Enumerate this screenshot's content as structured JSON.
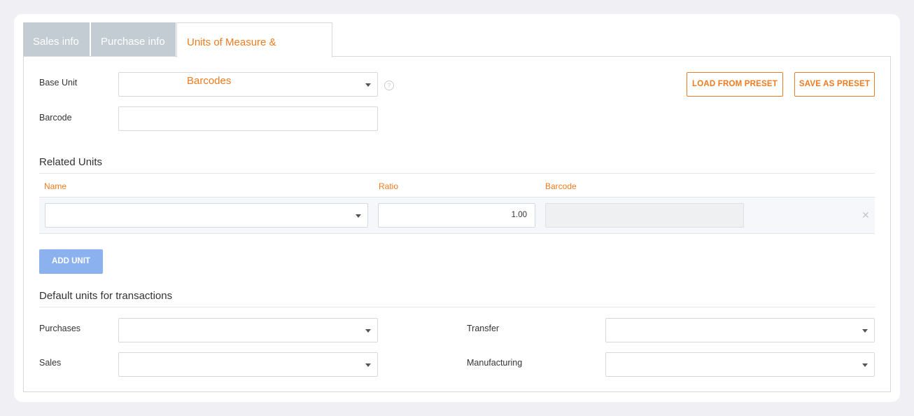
{
  "tabs": [
    {
      "label": "Sales info"
    },
    {
      "label": "Purchase info"
    },
    {
      "label": "Units of Measure & Barcodes"
    }
  ],
  "form": {
    "base_unit_label": "Base Unit",
    "base_unit_value": "",
    "barcode_label": "Barcode",
    "barcode_value": ""
  },
  "actions": {
    "load_preset": "LOAD FROM PRESET",
    "save_preset": "SAVE AS PRESET"
  },
  "related_units": {
    "title": "Related Units",
    "columns": [
      "Name",
      "Ratio",
      "Barcode"
    ],
    "rows": [
      {
        "name": "",
        "ratio": "1.00",
        "barcode": ""
      }
    ],
    "add_button": "ADD UNIT"
  },
  "defaults": {
    "title": "Default units for transactions",
    "purchases_label": "Purchases",
    "sales_label": "Sales",
    "transfer_label": "Transfer",
    "manufacturing_label": "Manufacturing"
  },
  "icons": {
    "help": "help-icon",
    "remove": "close-icon",
    "dropdown": "chevron-down-icon"
  },
  "colors": {
    "accent": "#f07a1e",
    "primary_button": "#8bb2ef",
    "inactive_tab": "#c4ccd3"
  }
}
